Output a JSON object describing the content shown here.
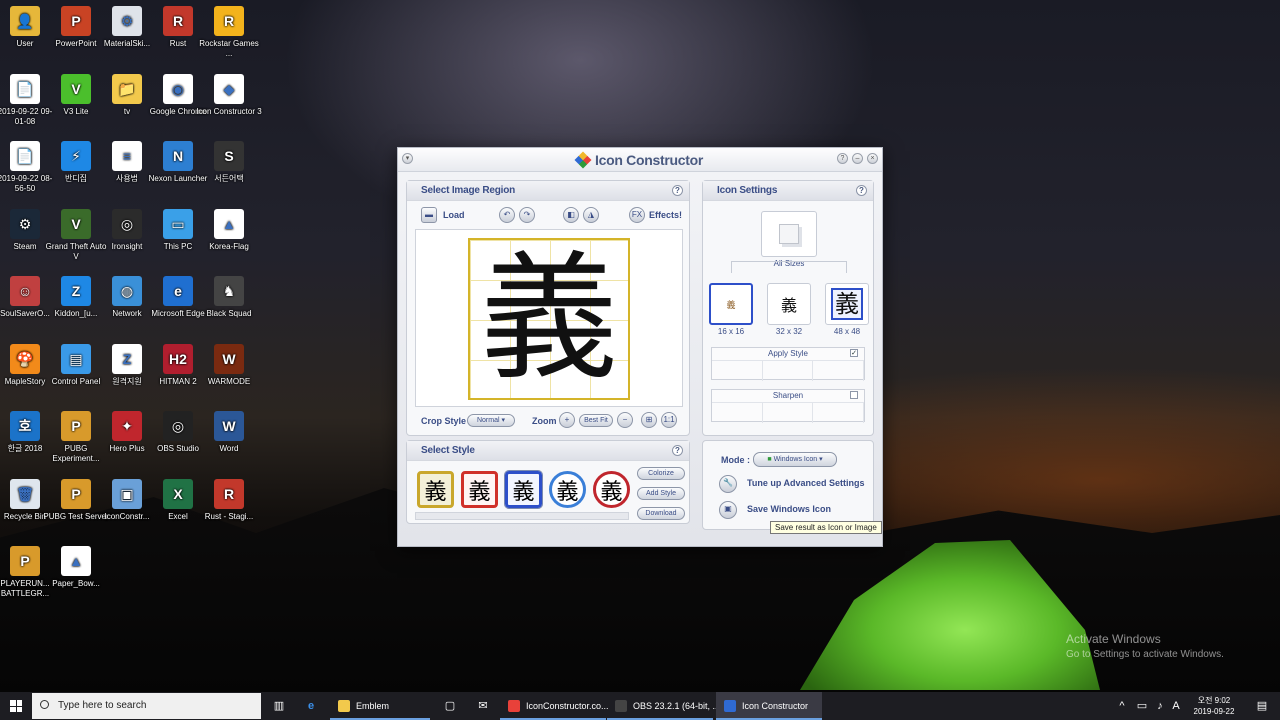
{
  "desktop": {
    "icons": [
      {
        "label": "User",
        "icon": "folder-user-icon",
        "color": "#e6b73a",
        "glyph": "👤"
      },
      {
        "label": "PowerPoint",
        "icon": "powerpoint-icon",
        "color": "#c94324",
        "glyph": "P"
      },
      {
        "label": "MaterialSki...",
        "icon": "file-icon",
        "color": "#dfe3ea",
        "glyph": "⚙"
      },
      {
        "label": "Rust",
        "icon": "rust-icon",
        "color": "#c2382b",
        "glyph": "R"
      },
      {
        "label": "Rockstar Games ...",
        "icon": "rockstar-icon",
        "color": "#f3b31c",
        "glyph": "R"
      },
      {
        "label": "2019-09-22 09-01-08",
        "icon": "file-icon",
        "color": "#ffffff",
        "glyph": "📄"
      },
      {
        "label": "V3 Lite",
        "icon": "v3-lite-icon",
        "color": "#4bbf2c",
        "glyph": "V"
      },
      {
        "label": "tv",
        "icon": "folder-icon",
        "color": "#f2c94c",
        "glyph": "📁"
      },
      {
        "label": "Google Chrome",
        "icon": "chrome-icon",
        "color": "#ffffff",
        "glyph": "◉"
      },
      {
        "label": "Icon Constructor 3",
        "icon": "icon-constructor-icon",
        "color": "#ffffff",
        "glyph": "◆"
      },
      {
        "label": "2019-09-22 08-56-50",
        "icon": "file-icon",
        "color": "#ffffff",
        "glyph": "📄"
      },
      {
        "label": "반디집",
        "icon": "bandizip-icon",
        "color": "#1e88e5",
        "glyph": "⚡"
      },
      {
        "label": "사용법",
        "icon": "text-file-icon",
        "color": "#ffffff",
        "glyph": "≡"
      },
      {
        "label": "Nexon Launcher",
        "icon": "nexon-icon",
        "color": "#2d7fd2",
        "glyph": "N"
      },
      {
        "label": "서든어택",
        "icon": "sudden-attack-icon",
        "color": "#333333",
        "glyph": "S"
      },
      {
        "label": "Steam",
        "icon": "steam-icon",
        "color": "#1b2838",
        "glyph": "⚙"
      },
      {
        "label": "Grand Theft Auto V",
        "icon": "gta-icon",
        "color": "#3a6b2a",
        "glyph": "V"
      },
      {
        "label": "Ironsight",
        "icon": "ironsight-icon",
        "color": "#2b2b2b",
        "glyph": "◎"
      },
      {
        "label": "This PC",
        "icon": "this-pc-icon",
        "color": "#3aa0e8",
        "glyph": "▭"
      },
      {
        "label": "Korea-Flag",
        "icon": "image-icon",
        "color": "#ffffff",
        "glyph": "▲"
      },
      {
        "label": "SoulSaverO...",
        "icon": "soulsaver-icon",
        "color": "#c04040",
        "glyph": "☺"
      },
      {
        "label": "Kiddon_[u...",
        "icon": "zip-icon",
        "color": "#1e88e5",
        "glyph": "Z"
      },
      {
        "label": "Network",
        "icon": "network-icon",
        "color": "#3a90d8",
        "glyph": "◍"
      },
      {
        "label": "Microsoft Edge",
        "icon": "edge-icon",
        "color": "#1f6fd0",
        "glyph": "e"
      },
      {
        "label": "Black Squad",
        "icon": "black-squad-icon",
        "color": "#444444",
        "glyph": "♞"
      },
      {
        "label": "MapleStory",
        "icon": "maplestory-icon",
        "color": "#f28a1a",
        "glyph": "🍄"
      },
      {
        "label": "Control Panel",
        "icon": "control-panel-icon",
        "color": "#3a9ae8",
        "glyph": "▤"
      },
      {
        "label": "원격지원",
        "icon": "remote-support-icon",
        "color": "#ffffff",
        "glyph": "Z"
      },
      {
        "label": "HITMAN 2",
        "icon": "hitman-icon",
        "color": "#b01e2e",
        "glyph": "H2"
      },
      {
        "label": "WARMODE",
        "icon": "warmode-icon",
        "color": "#7a2a10",
        "glyph": "W"
      },
      {
        "label": "한글 2018",
        "icon": "hangul-icon",
        "color": "#1b73c9",
        "glyph": "호"
      },
      {
        "label": "PUBG Experiment...",
        "icon": "pubg-icon",
        "color": "#d89a2b",
        "glyph": "P"
      },
      {
        "label": "Hero Plus",
        "icon": "hero-plus-icon",
        "color": "#c0262d",
        "glyph": "✦"
      },
      {
        "label": "OBS Studio",
        "icon": "obs-icon",
        "color": "#222222",
        "glyph": "◎"
      },
      {
        "label": "Word",
        "icon": "word-icon",
        "color": "#2b5797",
        "glyph": "W"
      },
      {
        "label": "Recycle Bin",
        "icon": "recycle-bin-icon",
        "color": "#dfe6ee",
        "glyph": "🗑"
      },
      {
        "label": "PUBG Test Server",
        "icon": "pubg-icon",
        "color": "#d89a2b",
        "glyph": "P"
      },
      {
        "label": "IconConstr...",
        "icon": "installer-icon",
        "color": "#6aa0d8",
        "glyph": "▣"
      },
      {
        "label": "Excel",
        "icon": "excel-icon",
        "color": "#207245",
        "glyph": "X"
      },
      {
        "label": "Rust - Stagi...",
        "icon": "rust-icon",
        "color": "#c2382b",
        "glyph": "R"
      },
      {
        "label": "PLAYERUN... BATTLEGR...",
        "icon": "pubg-icon",
        "color": "#d89a2b",
        "glyph": "P"
      },
      {
        "label": "Paper_Bow...",
        "icon": "image-icon",
        "color": "#ffffff",
        "glyph": "▲"
      }
    ],
    "watermark": {
      "line1": "Activate Windows",
      "line2": "Go to Settings to activate Windows."
    }
  },
  "window": {
    "title": "Icon Constructor",
    "select_region": {
      "title": "Select Image Region",
      "load_label": "Load",
      "effects_label": "Effects!",
      "fx_label": "FX",
      "glyph": "義",
      "crop_style_label": "Crop Style :",
      "crop_style_value": "Normal",
      "zoom_label": "Zoom :",
      "best_fit_label": "Best Fit",
      "one_to_one_label": "1:1"
    },
    "select_style": {
      "title": "Select Style",
      "colorize_label": "Colorize",
      "add_style_label": "Add Style",
      "download_label": "Download",
      "styles": [
        {
          "name": "gold-frame",
          "bg": "#f3f0d8",
          "border": "#c9a72c"
        },
        {
          "name": "red-frame",
          "bg": "#fff4f4",
          "border": "#d0302a"
        },
        {
          "name": "blue-frame",
          "bg": "#f2f5ff",
          "border": "#2d4fc9"
        },
        {
          "name": "blue-round",
          "bg": "#ffffff",
          "border": "#3a7fd8"
        },
        {
          "name": "red-round",
          "bg": "#ffffff",
          "border": "#c0262d"
        }
      ]
    },
    "icon_settings": {
      "title": "Icon Settings",
      "all_sizes_label": "All Sizes",
      "sizes": [
        "16 x 16",
        "32 x 32",
        "48 x 48"
      ],
      "apply_style_label": "Apply Style",
      "apply_style_checked": "✓",
      "sharpen_label": "Sharpen"
    },
    "mode": {
      "label": "Mode :",
      "value": "Windows Icon",
      "tune_label": "Tune up Advanced Settings",
      "save_label": "Save Windows Icon",
      "tooltip": "Save result as Icon or Image"
    }
  },
  "taskbar": {
    "search_placeholder": "Type here to search",
    "apps": [
      {
        "label": "Emblem",
        "color": "#f2c94c"
      },
      {
        "label": "IconConstructor.co...",
        "color": "#e8413a"
      },
      {
        "label": "OBS 23.2.1 (64-bit, ...",
        "color": "#444444"
      },
      {
        "label": "Icon Constructor",
        "color": "#2f6ad3"
      }
    ],
    "time": "오전 9:02",
    "date": "2019-09-22"
  }
}
